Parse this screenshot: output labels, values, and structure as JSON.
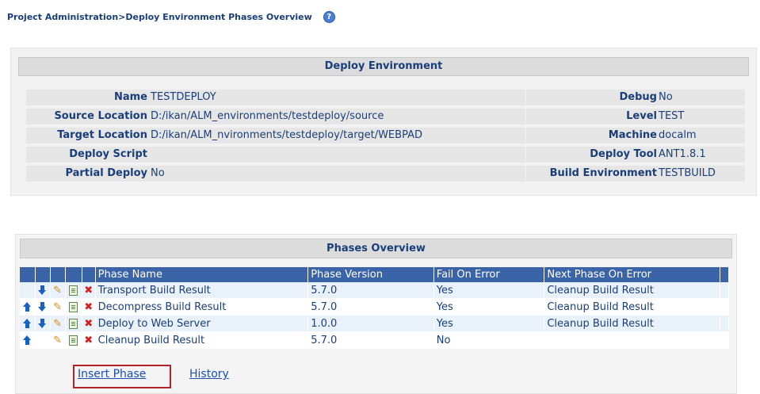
{
  "breadcrumb": "Project Administration>Deploy Environment Phases Overview",
  "env": {
    "header": "Deploy Environment",
    "left": [
      {
        "label": "Name",
        "value": "TESTDEPLOY"
      },
      {
        "label": "Source Location",
        "value": "D:/ikan/ALM_environments/testdeploy/source"
      },
      {
        "label": "Target Location",
        "value": "D:/ikan/ALM_nvironments/testdeploy/target/WEBPAD"
      },
      {
        "label": "Deploy Script",
        "value": ""
      },
      {
        "label": "Partial Deploy",
        "value": "No"
      }
    ],
    "right": [
      {
        "label": "Debug",
        "value": "No"
      },
      {
        "label": "Level",
        "value": "TEST"
      },
      {
        "label": "Machine",
        "value": "docalm"
      },
      {
        "label": "Deploy Tool",
        "value": "ANT1.8.1"
      },
      {
        "label": "Build Environment",
        "value": "TESTBUILD"
      }
    ]
  },
  "phases": {
    "header": "Phases Overview",
    "columns": [
      "Phase Name",
      "Phase Version",
      "Fail On Error",
      "Next Phase On Error"
    ],
    "rows": [
      {
        "name": "Transport Build Result",
        "version": "5.7.0",
        "fail": "Yes",
        "next": "Cleanup Build Result"
      },
      {
        "name": "Decompress Build Result",
        "version": "5.7.0",
        "fail": "Yes",
        "next": "Cleanup Build Result"
      },
      {
        "name": "Deploy to Web Server",
        "version": "1.0.0",
        "fail": "Yes",
        "next": "Cleanup Build Result"
      },
      {
        "name": "Cleanup Build Result",
        "version": "5.7.0",
        "fail": "No",
        "next": ""
      }
    ]
  },
  "links": {
    "insert": "Insert Phase",
    "history": "History"
  },
  "colors": {
    "header_blue": "#3a63a8",
    "text_navy": "#1a3e7a",
    "highlight_red": "#b3232b"
  }
}
